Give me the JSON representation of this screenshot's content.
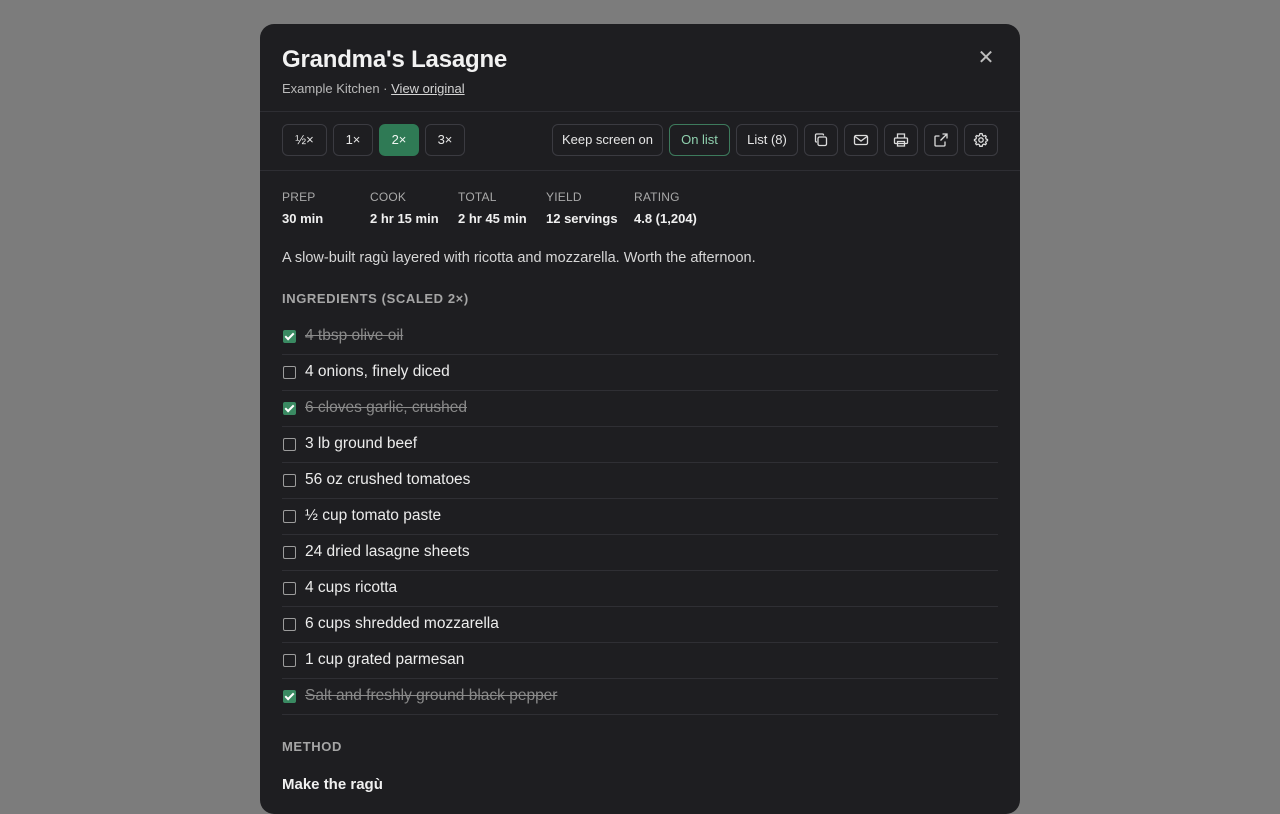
{
  "recipe": {
    "title": "Grandma's Lasagne",
    "source": "Example Kitchen",
    "separator": " · ",
    "view_original_label": "View original",
    "close_label": "✕",
    "description": "A slow-built ragù layered with ricotta and mozzarella. Worth the afternoon."
  },
  "toolbar": {
    "scale_options": [
      "½×",
      "1×",
      "2×",
      "3×"
    ],
    "selected_scale": "2×",
    "keep_screen_on_label": "Keep screen on",
    "on_list_label": "On list",
    "list_label": "List (8)",
    "icon_buttons": [
      "copy-icon",
      "mail-icon",
      "print-icon",
      "external-link-icon",
      "gear-icon"
    ]
  },
  "meta": [
    {
      "label": "PREP",
      "value": "30 min"
    },
    {
      "label": "COOK",
      "value": "2 hr 15 min"
    },
    {
      "label": "TOTAL",
      "value": "2 hr 45 min"
    },
    {
      "label": "YIELD",
      "value": "12 servings"
    },
    {
      "label": "RATING",
      "value": "4.8 (1,204)"
    }
  ],
  "ingredients": {
    "heading": "INGREDIENTS (SCALED 2×)",
    "items": [
      {
        "text": "4 tbsp olive oil",
        "checked": true
      },
      {
        "text": "4 onions, finely diced",
        "checked": false
      },
      {
        "text": "6 cloves garlic, crushed",
        "checked": true
      },
      {
        "text": "3 lb ground beef",
        "checked": false
      },
      {
        "text": "56 oz crushed tomatoes",
        "checked": false
      },
      {
        "text": "½ cup tomato paste",
        "checked": false
      },
      {
        "text": "24 dried lasagne sheets",
        "checked": false
      },
      {
        "text": "4 cups ricotta",
        "checked": false
      },
      {
        "text": "6 cups shredded mozzarella",
        "checked": false
      },
      {
        "text": "1 cup grated parmesan",
        "checked": false
      },
      {
        "text": "Salt and freshly ground black pepper",
        "checked": true
      }
    ]
  },
  "method": {
    "heading": "METHOD",
    "first_step_title": "Make the ragù"
  },
  "colors": {
    "modal_bg": "#1e1e21",
    "accent_green": "#2f7a55",
    "backdrop": "#7c7c7c"
  }
}
